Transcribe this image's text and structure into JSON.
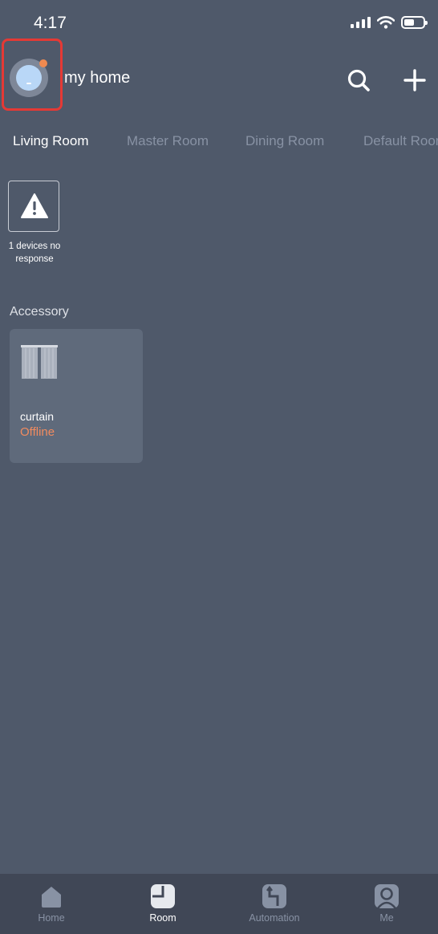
{
  "status_bar": {
    "time": "4:17",
    "icons": [
      "signal-icon",
      "wifi-icon",
      "battery-icon"
    ]
  },
  "header": {
    "title": "my home",
    "avatar_icon": "home-avatar-icon",
    "notification_dot_color": "#f08a50",
    "highlight_color": "#e53935",
    "actions": [
      "search-icon",
      "plus-icon"
    ]
  },
  "tabs": [
    {
      "label": "Living Room",
      "active": true
    },
    {
      "label": "Master Room",
      "active": false
    },
    {
      "label": "Dining Room",
      "active": false
    },
    {
      "label": "Default Room",
      "active": false
    }
  ],
  "alert": {
    "icon": "warning-icon",
    "caption": "1 devices no response"
  },
  "accessory": {
    "section_label": "Accessory",
    "devices": [
      {
        "name": "curtain",
        "status": "Offline",
        "icon": "curtain-icon",
        "status_color": "#f28b5f"
      }
    ]
  },
  "bottom_nav": [
    {
      "label": "Home",
      "icon": "home-icon",
      "active": false
    },
    {
      "label": "Room",
      "icon": "room-icon",
      "active": true
    },
    {
      "label": "Automation",
      "icon": "automation-icon",
      "active": false
    },
    {
      "label": "Me",
      "icon": "person-icon",
      "active": false
    }
  ],
  "colors": {
    "background": "#4f596a",
    "nav_background": "#404756",
    "inactive_text": "#8892a4"
  }
}
